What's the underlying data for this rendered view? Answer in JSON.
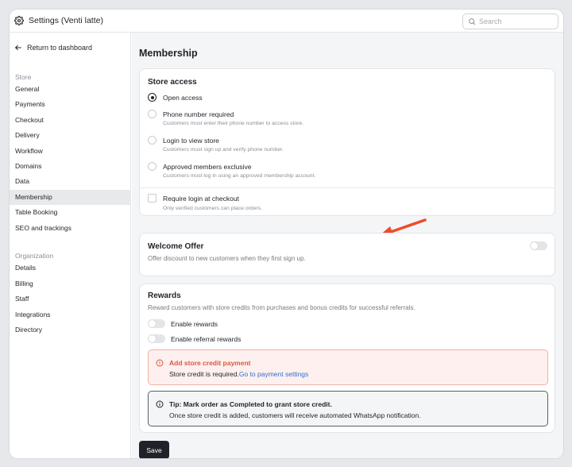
{
  "window": {
    "title": "Settings (Venti latte)"
  },
  "search": {
    "placeholder": "Search"
  },
  "sidebar": {
    "back_label": "Return to dashboard",
    "store_label": "Store",
    "store_items": [
      "General",
      "Payments",
      "Checkout",
      "Delivery",
      "Workflow",
      "Domains",
      "Data",
      "Membership",
      "Table Booking",
      "SEO and trackings"
    ],
    "active_item": "Membership",
    "org_label": "Organization",
    "org_items": [
      "Details",
      "Billing",
      "Staff",
      "Integrations",
      "Directory"
    ]
  },
  "main": {
    "title": "Membership",
    "store_access": {
      "title": "Store access",
      "options": [
        {
          "label": "Open access",
          "sub": "",
          "selected": true
        },
        {
          "label": "Phone number required",
          "sub": "Customers must enter their phone number to access store.",
          "selected": false
        },
        {
          "label": "Login to view store",
          "sub": "Customers must sign up and verify phone number.",
          "selected": false
        },
        {
          "label": "Approved members exclusive",
          "sub": "Customers must log in using an approved membership account.",
          "selected": false
        }
      ],
      "checkout": {
        "label": "Require login at checkout",
        "sub": "Only verified customers can place orders.",
        "checked": false
      }
    },
    "welcome_offer": {
      "title": "Welcome Offer",
      "description": "Offer discount to new customers when they first sign up.",
      "enabled": false
    },
    "rewards": {
      "title": "Rewards",
      "description": "Reward customers with store credits from purchases and bonus credits for successful referrals.",
      "toggles": [
        {
          "label": "Enable rewards",
          "enabled": false
        },
        {
          "label": "Enable referral rewards",
          "enabled": false
        }
      ],
      "error": {
        "title": "Add store credit payment",
        "body": "Store credit is required.",
        "link": "Go to payment settings"
      },
      "tip": {
        "title": "Tip: Mark order as Completed to grant store credit.",
        "body": "Once store credit is added, customers will receive automated WhatsApp notification."
      }
    },
    "save_label": "Save"
  },
  "colors": {
    "accent": "#1f2329",
    "error": "#e05545",
    "link": "#2f6fd0",
    "annotation_arrow": "#ef4b2a"
  },
  "icons": [
    "gear-icon",
    "search-icon",
    "arrow-left-icon",
    "alert-circle-icon",
    "info-icon",
    "annotation-arrow"
  ]
}
